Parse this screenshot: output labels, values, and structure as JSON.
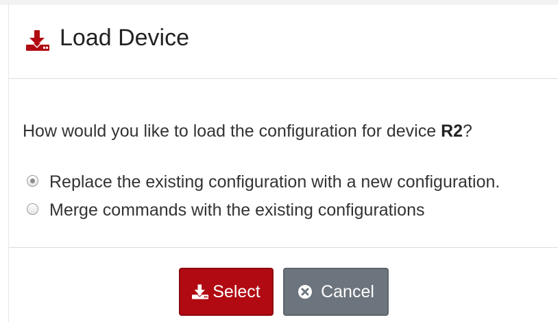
{
  "dialog": {
    "title": "Load Device",
    "title_icon": "download-icon",
    "accent_color": "#b10a12"
  },
  "body": {
    "question_prefix": "How would you like to load the configuration for device ",
    "device_name": "R2",
    "question_suffix": "?",
    "options": [
      {
        "label": "Replace the existing configuration with a new configuration.",
        "selected": true
      },
      {
        "label": "Merge commands with the existing configurations",
        "selected": false
      }
    ]
  },
  "footer": {
    "select_label": "Select",
    "select_icon": "download-icon",
    "select_color": "#b10a12",
    "cancel_label": "Cancel",
    "cancel_icon": "close-circle-icon",
    "cancel_color": "#6c747d"
  }
}
